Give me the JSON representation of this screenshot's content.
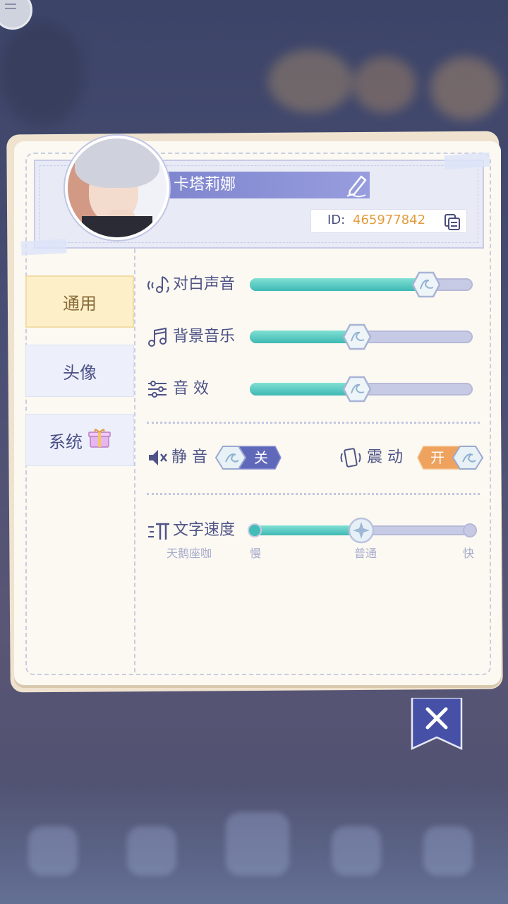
{
  "profile": {
    "name": "卡塔莉娜",
    "id_label": "ID:",
    "id_value": "465977842"
  },
  "tabs": [
    {
      "label": "通用",
      "active": true
    },
    {
      "label": "头像",
      "active": false
    },
    {
      "label": "系统",
      "active": false
    }
  ],
  "audio": {
    "dialogue": {
      "label": "对白声音",
      "level": 0.79
    },
    "bgm": {
      "label": "背景音乐",
      "level": 0.48
    },
    "sfx": {
      "label": "音 效",
      "level": 0.48
    }
  },
  "toggles": {
    "mute": {
      "label": "静 音",
      "state_text": "关",
      "on": false
    },
    "vibrate": {
      "label": "震 动",
      "state_text": "开",
      "on": true
    }
  },
  "text_speed": {
    "label": "文字速度",
    "preview": "天鹅座咖",
    "ticks": [
      "慢",
      "普通",
      "快"
    ],
    "level": 0.5
  },
  "colors": {
    "accent_teal": "#3fb8b4",
    "accent_orange": "#e39b3d",
    "tab_active_bg": "#fdf0c9",
    "track_bg": "#c7cae4"
  },
  "icons": {
    "edit": "pencil-icon",
    "copy": "copy-icon",
    "dialogue": "voice-note-icon",
    "bgm": "music-note-icon",
    "sfx": "sliders-icon",
    "mute": "speaker-mute-icon",
    "vibrate": "phone-vibrate-icon",
    "text_speed": "text-speed-icon",
    "gift": "gift-icon",
    "close": "close-icon"
  }
}
